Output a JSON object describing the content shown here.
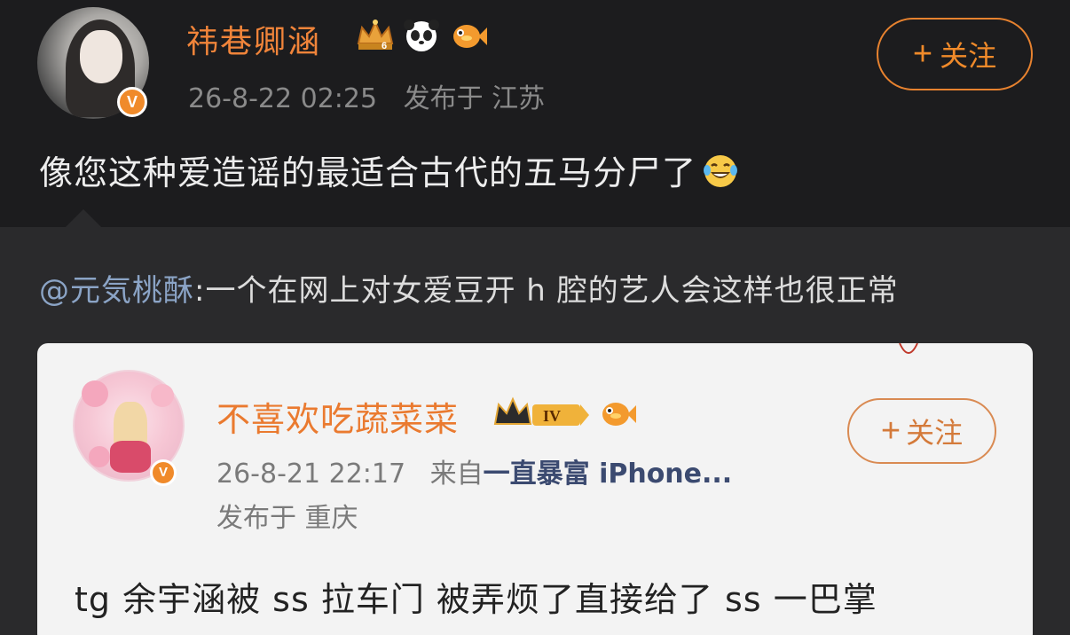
{
  "post": {
    "username": "祎巷卿涵",
    "badge_icons": [
      "crown-level-6-icon",
      "panda-icon",
      "fish-icon"
    ],
    "crown_level": "6",
    "timestamp": "26-8-22 02:25",
    "location": "发布于 江苏",
    "follow_label": "关注",
    "text": "像您这种爱造谣的最适合古代的五马分尸了",
    "emoji": "laughing-tears-emoji"
  },
  "repost": {
    "mention": "@元気桃酥",
    "text": ":一个在网上对女爱豆开 h 腔的艺人会这样也很正常"
  },
  "card": {
    "username": "不喜欢吃蔬菜菜",
    "badge_icons": [
      "crown-level-iv-icon",
      "fish-icon"
    ],
    "crown_level": "IV",
    "timestamp": "26-8-21 22:17",
    "source_prefix": "来自",
    "source": "一直暴富 iPhone...",
    "location": "发布于 重庆",
    "follow_label": "关注",
    "text": "tg 余宇涵被 ss 拉车门  被弄烦了直接给了 ss 一巴掌"
  },
  "colors": {
    "background": "#1c1c1e",
    "repost_background": "#2a2a2c",
    "accent": "#f0843a",
    "mention": "#8ba4c6",
    "card_background": "#f3f3f3"
  }
}
